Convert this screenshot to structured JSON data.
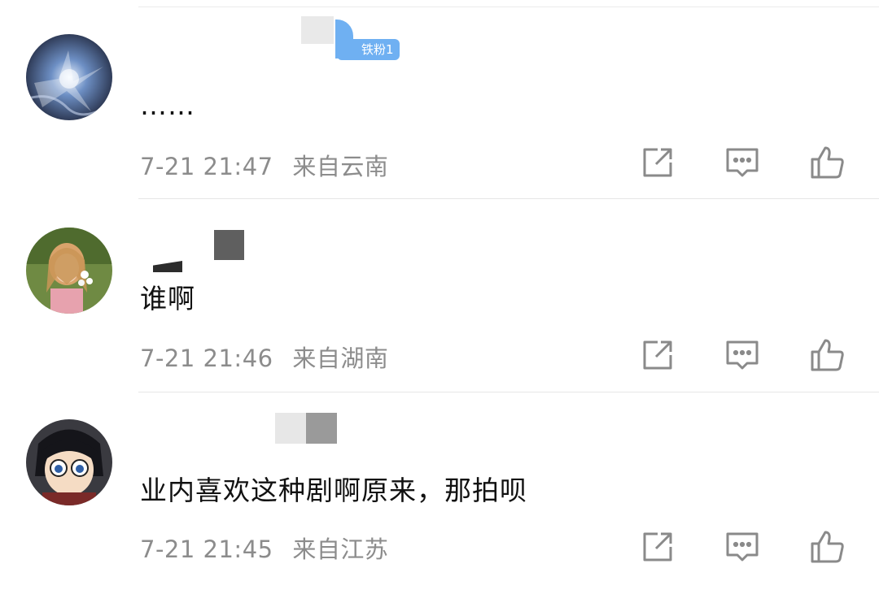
{
  "comments": [
    {
      "text": "……",
      "time": "7-21 21:47",
      "location": "来自云南",
      "badge": "铁粉1",
      "avatar": "galaxy-eye-avatar"
    },
    {
      "text": "谁啊",
      "time": "7-21 21:46",
      "location": "来自湖南",
      "avatar": "girl-with-flowers-avatar"
    },
    {
      "text": "业内喜欢这种剧啊原来，那拍呗",
      "time": "7-21 21:45",
      "location": "来自江苏",
      "avatar": "anime-boy-avatar"
    }
  ],
  "colors": {
    "meta": "#8c8c8c",
    "badge": "#6fb0f2",
    "icon": "#8a8a8a"
  }
}
